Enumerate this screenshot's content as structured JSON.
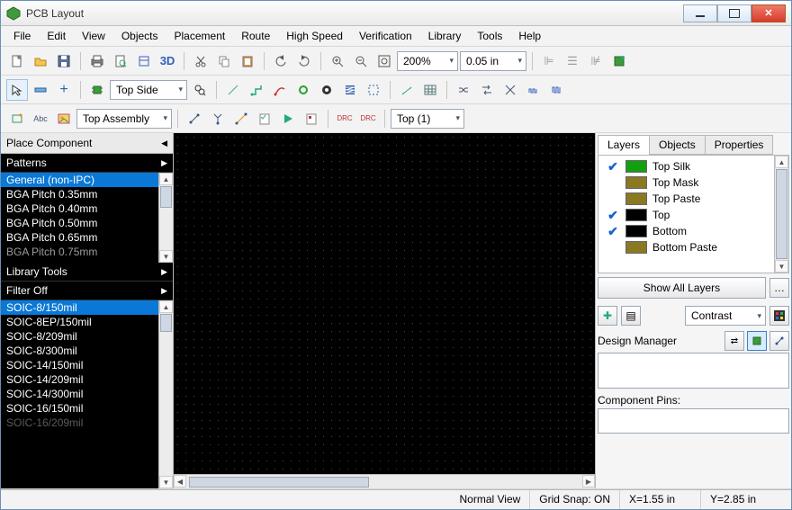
{
  "window": {
    "title": "PCB Layout"
  },
  "menu": [
    "File",
    "Edit",
    "View",
    "Objects",
    "Placement",
    "Route",
    "High Speed",
    "Verification",
    "Library",
    "Tools",
    "Help"
  ],
  "toolbar1": {
    "threeD": "3D",
    "zoom": "200%",
    "grid": "0.05 in"
  },
  "toolbar2": {
    "layer": "Top Side"
  },
  "toolbar3": {
    "assembly": "Top Assembly",
    "topn": "Top (1)"
  },
  "left": {
    "place_component": "Place Component",
    "patterns": "Patterns",
    "general_list": [
      "General (non-IPC)",
      "BGA Pitch 0.35mm",
      "BGA Pitch 0.40mm",
      "BGA Pitch 0.50mm",
      "BGA Pitch 0.65mm",
      "BGA Pitch 0.75mm"
    ],
    "library_tools": "Library Tools",
    "filter": "Filter Off",
    "soic_list": [
      "SOIC-8/150mil",
      "SOIC-8EP/150mil",
      "SOIC-8/209mil",
      "SOIC-8/300mil",
      "SOIC-14/150mil",
      "SOIC-14/209mil",
      "SOIC-14/300mil",
      "SOIC-16/150mil",
      "SOIC-16/209mil"
    ]
  },
  "right": {
    "tabs": [
      "Layers",
      "Objects",
      "Properties"
    ],
    "layers": [
      {
        "on": true,
        "color": "#12a012",
        "name": "Top Silk"
      },
      {
        "on": false,
        "color": "#8a7823",
        "name": "Top Mask"
      },
      {
        "on": false,
        "color": "#8a7823",
        "name": "Top Paste"
      },
      {
        "on": true,
        "color": "#000000",
        "name": "Top"
      },
      {
        "on": true,
        "color": "#000000",
        "name": "Bottom"
      },
      {
        "on": false,
        "color": "#8a7823",
        "name": "Bottom Paste"
      }
    ],
    "show_all": "Show All Layers",
    "contrast": "Contrast",
    "design_manager": "Design Manager",
    "component_pins": "Component Pins:"
  },
  "status": {
    "view": "Normal View",
    "snap": "Grid Snap: ON",
    "x": "X=1.55 in",
    "y": "Y=2.85 in"
  }
}
